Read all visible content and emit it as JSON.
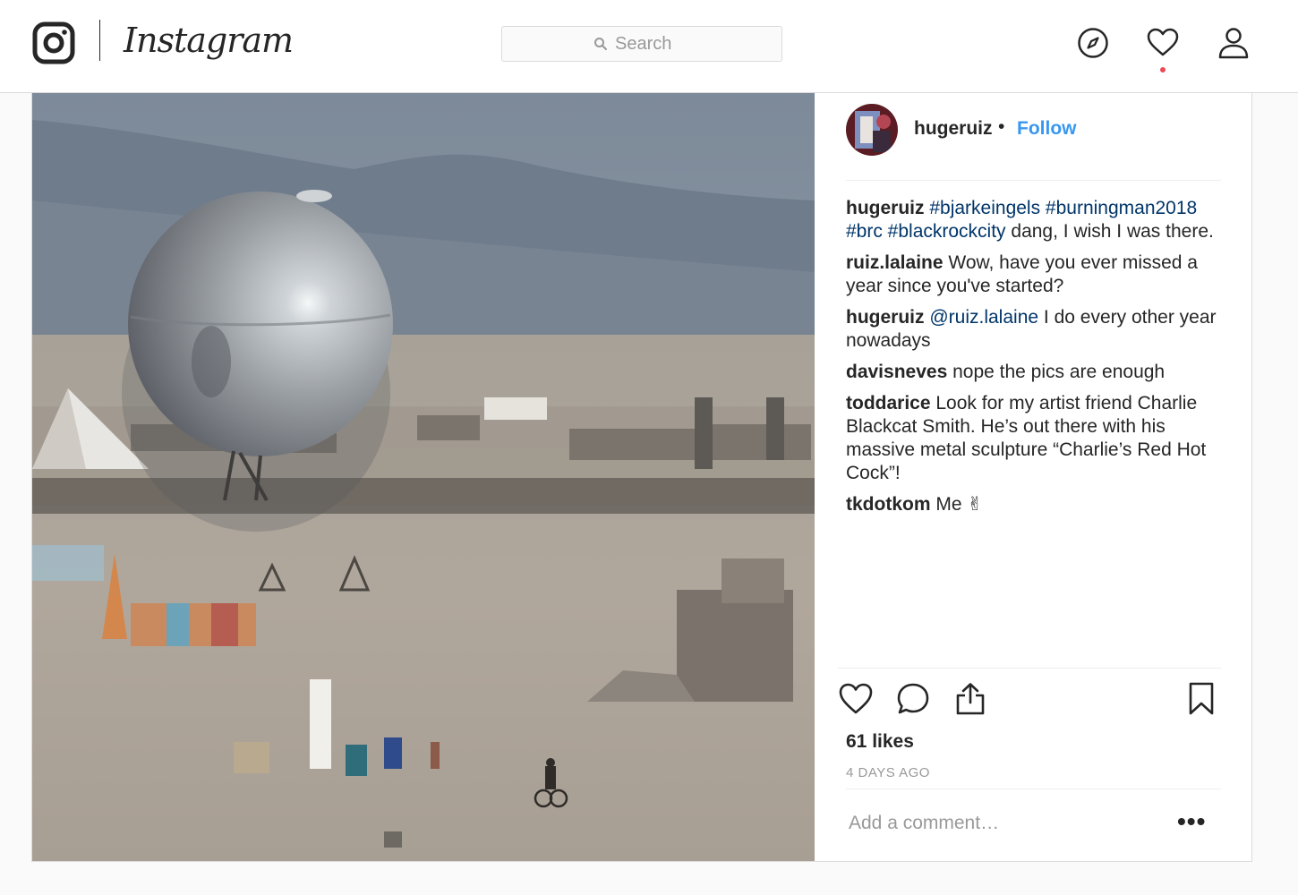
{
  "app": {
    "name": "Instagram"
  },
  "header": {
    "search_placeholder": "Search",
    "icons": [
      "instagram-logo-icon",
      "search-icon",
      "compass-icon",
      "heart-icon",
      "user-icon"
    ],
    "notification_dot_color": "#ed4956"
  },
  "post": {
    "author": "hugeruiz",
    "follow_label": "Follow",
    "follow_color": "#3897f0",
    "image_subject": "",
    "caption": {
      "user": "hugeruiz",
      "hashtags": "#bjarkeingels #burningman2018 #brc #blackrockcity",
      "text": " dang, I wish I was there."
    },
    "comments": [
      {
        "user": "ruiz.lalaine",
        "mention": "",
        "text": " Wow, have you ever missed a year since you've started?"
      },
      {
        "user": "hugeruiz",
        "mention": "@ruiz.lalaine",
        "text": " I do every other year nowadays"
      },
      {
        "user": "davisneves",
        "mention": "",
        "text": " nope the pics are enough"
      },
      {
        "user": "toddarice",
        "mention": "",
        "text": " Look for my artist friend Charlie Blackcat Smith. He’s out there with his massive metal sculpture “Charlie’s Red Hot Cock”!"
      },
      {
        "user": "tkdotkom",
        "mention": "",
        "text": " Me ✌"
      }
    ],
    "likes": "61 likes",
    "time": "4 DAYS AGO",
    "add_comment_placeholder": "Add a comment…",
    "more_label": "•••"
  }
}
